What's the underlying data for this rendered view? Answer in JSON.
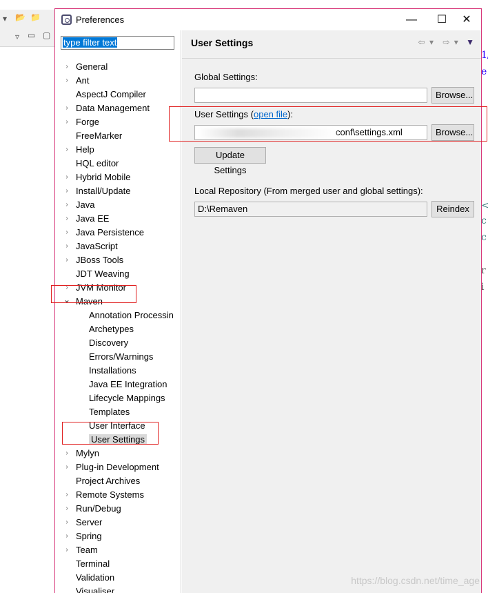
{
  "window": {
    "title": "Preferences",
    "minimize": "—",
    "maximize": "☐",
    "close": "✕"
  },
  "filter": {
    "value": "type filter text"
  },
  "tree": [
    {
      "label": "General",
      "arrow": "›",
      "indent": 0
    },
    {
      "label": "Ant",
      "arrow": "›",
      "indent": 0
    },
    {
      "label": "AspectJ Compiler",
      "arrow": "",
      "indent": 0
    },
    {
      "label": "Data Management",
      "arrow": "›",
      "indent": 0
    },
    {
      "label": "Forge",
      "arrow": "›",
      "indent": 0
    },
    {
      "label": "FreeMarker",
      "arrow": "",
      "indent": 0
    },
    {
      "label": "Help",
      "arrow": "›",
      "indent": 0
    },
    {
      "label": "HQL editor",
      "arrow": "",
      "indent": 0
    },
    {
      "label": "Hybrid Mobile",
      "arrow": "›",
      "indent": 0
    },
    {
      "label": "Install/Update",
      "arrow": "›",
      "indent": 0
    },
    {
      "label": "Java",
      "arrow": "›",
      "indent": 0
    },
    {
      "label": "Java EE",
      "arrow": "›",
      "indent": 0
    },
    {
      "label": "Java Persistence",
      "arrow": "›",
      "indent": 0
    },
    {
      "label": "JavaScript",
      "arrow": "›",
      "indent": 0
    },
    {
      "label": "JBoss Tools",
      "arrow": "›",
      "indent": 0
    },
    {
      "label": "JDT Weaving",
      "arrow": "",
      "indent": 0
    },
    {
      "label": "JVM Monitor",
      "arrow": "›",
      "indent": 0
    },
    {
      "label": "Maven",
      "arrow": "⌄",
      "indent": 0
    },
    {
      "label": "Annotation Processin",
      "arrow": "",
      "indent": 1
    },
    {
      "label": "Archetypes",
      "arrow": "",
      "indent": 1
    },
    {
      "label": "Discovery",
      "arrow": "",
      "indent": 1
    },
    {
      "label": "Errors/Warnings",
      "arrow": "",
      "indent": 1
    },
    {
      "label": "Installations",
      "arrow": "",
      "indent": 1
    },
    {
      "label": "Java EE Integration",
      "arrow": "",
      "indent": 1
    },
    {
      "label": "Lifecycle Mappings",
      "arrow": "",
      "indent": 1
    },
    {
      "label": "Templates",
      "arrow": "",
      "indent": 1
    },
    {
      "label": "User Interface",
      "arrow": "",
      "indent": 1
    },
    {
      "label": "User Settings",
      "arrow": "",
      "indent": 1,
      "selected": true
    },
    {
      "label": "Mylyn",
      "arrow": "›",
      "indent": 0
    },
    {
      "label": "Plug-in Development",
      "arrow": "›",
      "indent": 0
    },
    {
      "label": "Project Archives",
      "arrow": "",
      "indent": 0
    },
    {
      "label": "Remote Systems",
      "arrow": "›",
      "indent": 0
    },
    {
      "label": "Run/Debug",
      "arrow": "›",
      "indent": 0
    },
    {
      "label": "Server",
      "arrow": "›",
      "indent": 0
    },
    {
      "label": "Spring",
      "arrow": "›",
      "indent": 0
    },
    {
      "label": "Team",
      "arrow": "›",
      "indent": 0
    },
    {
      "label": "Terminal",
      "arrow": "",
      "indent": 0
    },
    {
      "label": "Validation",
      "arrow": "",
      "indent": 0
    },
    {
      "label": "Visualiser",
      "arrow": "",
      "indent": 0
    }
  ],
  "page": {
    "title": "User Settings",
    "nav": {
      "back": "⇦",
      "forward": "⇨",
      "dropdown": "▾",
      "menu": "▼"
    },
    "global_label": "Global Settings:",
    "global_value": "",
    "browse": "Browse...",
    "user_label_prefix": "User Settings (",
    "open_file": "open file",
    "user_label_suffix": "):",
    "user_value_visible": "conf\\settings.xml",
    "update_settings": "Update Settings",
    "local_repo_label": "Local Repository (From merged user and global settings):",
    "local_repo_value": "D:\\Remaven",
    "reindex": "Reindex"
  },
  "watermark": "https://blog.csdn.net/time_age"
}
